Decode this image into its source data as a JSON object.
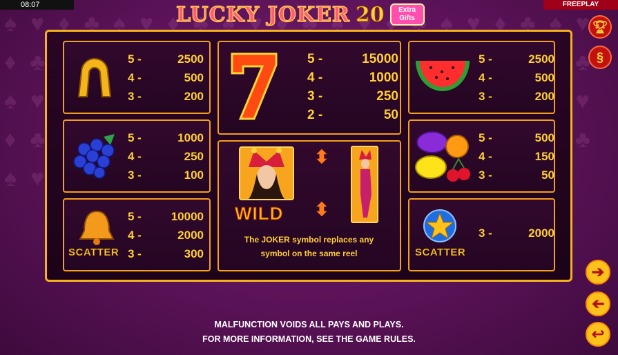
{
  "status": {
    "clock": "08:07",
    "mode": "FREEPLAY"
  },
  "logo": {
    "title": "LUCKY JOKER",
    "number": "20",
    "badge": "Extra Gifts"
  },
  "paytable": {
    "horseshoe": {
      "icon": "horseshoe-icon",
      "rows": [
        [
          "5 -",
          "2500"
        ],
        [
          "4 -",
          "500"
        ],
        [
          "3 -",
          "200"
        ]
      ]
    },
    "grapes": {
      "icon": "grapes-icon",
      "rows": [
        [
          "5 -",
          "1000"
        ],
        [
          "4 -",
          "250"
        ],
        [
          "3 -",
          "100"
        ]
      ]
    },
    "bell": {
      "icon": "bell-icon",
      "label": "SCATTER",
      "rows": [
        [
          "5 -",
          "10000"
        ],
        [
          "4 -",
          "2000"
        ],
        [
          "3 -",
          "300"
        ]
      ]
    },
    "seven": {
      "icon": "seven-icon",
      "rows": [
        [
          "5 -",
          "15000"
        ],
        [
          "4 -",
          "1000"
        ],
        [
          "3 -",
          "250"
        ],
        [
          "2 -",
          "50"
        ]
      ]
    },
    "joker": {
      "label": "WILD",
      "description_line1": "The JOKER symbol replaces any",
      "description_line2": "symbol on the same reel"
    },
    "watermelon": {
      "icon": "watermelon-icon",
      "rows": [
        [
          "5 -",
          "2500"
        ],
        [
          "4 -",
          "500"
        ],
        [
          "3 -",
          "200"
        ]
      ]
    },
    "fruits": {
      "icon": "fruit-mix-icon",
      "rows": [
        [
          "5 -",
          "500"
        ],
        [
          "4 -",
          "150"
        ],
        [
          "3 -",
          "50"
        ]
      ]
    },
    "star": {
      "icon": "star-icon",
      "label": "SCATTER",
      "rows": [
        [
          "3 -",
          "2000"
        ]
      ]
    }
  },
  "footer": {
    "line1": "MALFUNCTION VOIDS ALL PAYS AND PLAYS.",
    "line2": "FOR MORE INFORMATION, SEE THE GAME RULES."
  }
}
